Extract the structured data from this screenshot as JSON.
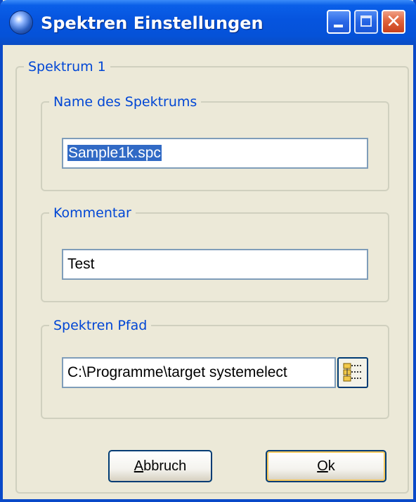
{
  "window": {
    "title": "Spektren Einstellungen",
    "controls": [
      "minimize-icon",
      "maximize-icon",
      "close-icon"
    ]
  },
  "main_group": {
    "legend": "Spektrum 1"
  },
  "name_group": {
    "legend": "Name des Spektrums",
    "value": "Sample1k.spc",
    "selected": true
  },
  "comment_group": {
    "legend": "Kommentar",
    "value": "Test"
  },
  "path_group": {
    "legend": "Spektren Pfad",
    "value": "C:\\Programme\\target systemelect",
    "browse_icon": "folder-tree-icon"
  },
  "buttons": {
    "cancel_mnemonic": "A",
    "cancel_rest": "bbruch",
    "ok_mnemonic": "O",
    "ok_rest": "k"
  },
  "colors": {
    "titlebar": "#0654DE",
    "legend_text": "#0046D5",
    "selection": "#316AC5",
    "dialog_bg": "#ECE9D8"
  }
}
